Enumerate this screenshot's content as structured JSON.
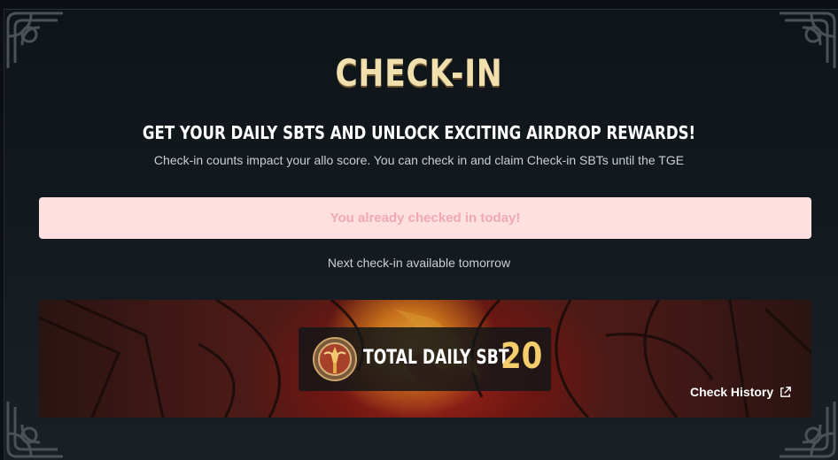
{
  "header": {
    "title": "CHECK-IN",
    "subtitle": "GET YOUR DAILY SBTS AND UNLOCK EXCITING AIRDROP REWARDS!",
    "description": "Check-in counts impact your allo score. You can check in and claim Check-in SBTs until the TGE"
  },
  "status": {
    "message": "You already checked in today!",
    "next_checkin": "Next check-in available tomorrow"
  },
  "rewards": {
    "label": "TOTAL DAILY SBT",
    "value": "20",
    "history_link": "Check History"
  },
  "icons": {
    "medal": "sbt-medal-icon",
    "external": "external-link-icon",
    "corner": "celtic-knot-corner-ornament"
  },
  "colors": {
    "title": "#f2dfae",
    "banner_bg": "#ffe0e1",
    "banner_text": "#f0a9b0",
    "value": "#f5cd6c"
  }
}
